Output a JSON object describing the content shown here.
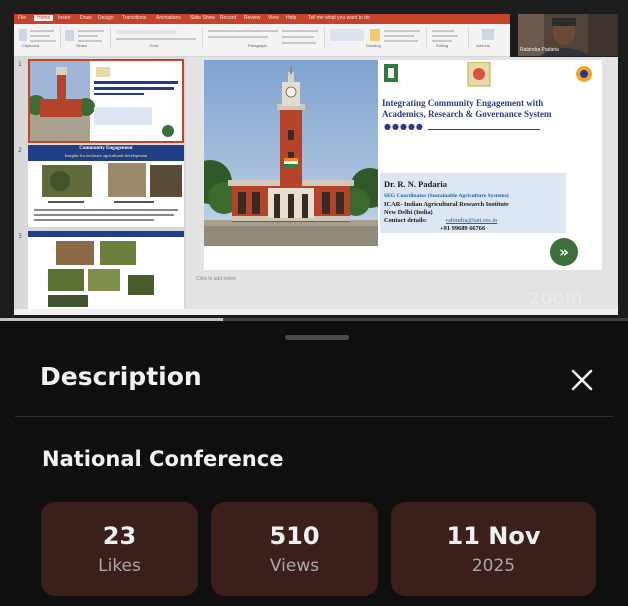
{
  "ppt": {
    "tabs": [
      "File",
      "Home",
      "Insert",
      "Draw",
      "Design",
      "Transitions",
      "Animations",
      "Slide Show",
      "Record",
      "Review",
      "View",
      "Help",
      "Tell me what you want to do"
    ],
    "ribbon_groups": [
      "Clipboard",
      "Slides",
      "Font",
      "Paragraph",
      "Drawing",
      "Editing",
      "Add-ins"
    ],
    "notes_placeholder": "Click to add notes",
    "thumb_numbers": [
      "1",
      "2",
      "3"
    ]
  },
  "webcam": {
    "name": "Rabindra Padaria"
  },
  "thumb2": {
    "heading": "Community Engagement",
    "subheading": "Insights for inclusive agricultural development"
  },
  "slide": {
    "title_line1": "Integrating Community Engagement with",
    "title_line2": "Academics, Research  & Governance System",
    "bullets": "●●●●●",
    "presenter": "Dr. R. N. Padaria",
    "role": "SEG Coordinator (Sustainable Agriculture Systems)",
    "institute": "ICAR- Indian Agricultural Research Institute",
    "city": "New Delhi (India)",
    "contact_label": "Contact details:",
    "email": "rabindra@iari.res.in",
    "phone": "+91 99689 66766",
    "next_glyph": "»"
  },
  "zoom_watermark": "zoom",
  "player": {
    "progress_fraction": 0.355
  },
  "sheet": {
    "heading": "Description",
    "close_glyph": "✕",
    "video_title": "National Conference",
    "stats": [
      {
        "value": "23",
        "label": "Likes"
      },
      {
        "value": "510",
        "label": "Views"
      },
      {
        "value": "11 Nov",
        "label": "2025"
      }
    ]
  },
  "colors": {
    "ppt_accent": "#c4432b",
    "tower_red": "#b5432a",
    "slide_title": "#2a3a8a",
    "contact_box": "#dde7f4",
    "stat_card": "#3a1f1a",
    "sheet_bg": "#0f0f0f",
    "next_button": "#3c6e3a"
  }
}
